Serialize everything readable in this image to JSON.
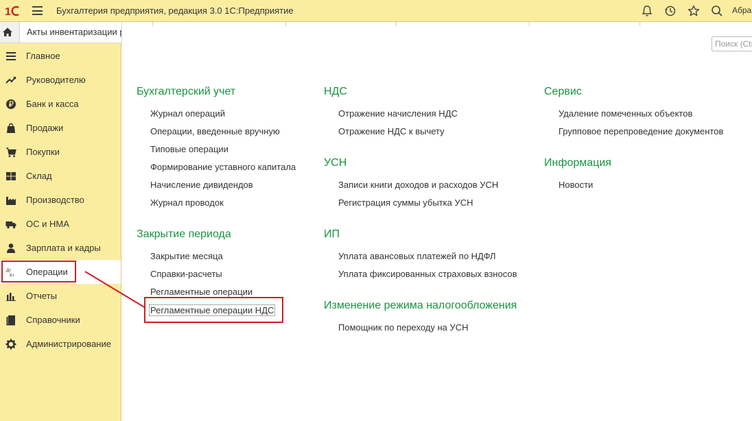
{
  "titlebar": {
    "logo": "1С",
    "app_title": "Бухгалтерия предприятия, редакция 3.0 1С:Предприятие",
    "user": "Абрам"
  },
  "tabs": {
    "open_tab": "Акты инвентаризации расчетов"
  },
  "sidebar": {
    "items": [
      {
        "label": "Главное",
        "icon": "menu-lines-icon"
      },
      {
        "label": "Руководителю",
        "icon": "trend-icon"
      },
      {
        "label": "Банк и касса",
        "icon": "ruble-icon"
      },
      {
        "label": "Продажи",
        "icon": "bag-icon"
      },
      {
        "label": "Покупки",
        "icon": "cart-icon"
      },
      {
        "label": "Склад",
        "icon": "warehouse-icon"
      },
      {
        "label": "Производство",
        "icon": "factory-icon"
      },
      {
        "label": "ОС и НМА",
        "icon": "truck-icon"
      },
      {
        "label": "Зарплата и кадры",
        "icon": "person-icon"
      },
      {
        "label": "Операции",
        "icon": "dt-kt-icon",
        "icon_text_top": "Дт",
        "icon_text_bottom": "Кт"
      },
      {
        "label": "Отчеты",
        "icon": "bar-chart-icon"
      },
      {
        "label": "Справочники",
        "icon": "books-icon"
      },
      {
        "label": "Администрирование",
        "icon": "gear-icon"
      }
    ],
    "active_index": 9
  },
  "search": {
    "placeholder": "Поиск (Ctrl+F)"
  },
  "sections": {
    "accounting": {
      "title": "Бухгалтерский учет",
      "links": [
        "Журнал операций",
        "Операции, введенные вручную",
        "Типовые операции",
        "Формирование уставного капитала",
        "Начисление дивидендов",
        "Журнал проводок"
      ]
    },
    "period_closing": {
      "title": "Закрытие периода",
      "links": [
        "Закрытие месяца",
        "Справки-расчеты",
        "Регламентные операции",
        "Регламентные операции НДС"
      ]
    },
    "vat": {
      "title": "НДС",
      "links": [
        "Отражение начисления НДС",
        "Отражение НДС к вычету"
      ]
    },
    "usn": {
      "title": "УСН",
      "links": [
        "Записи книги доходов и расходов УСН",
        "Регистрация суммы убытка УСН"
      ]
    },
    "ip": {
      "title": "ИП",
      "links": [
        "Уплата авансовых платежей по НДФЛ",
        "Уплата фиксированных страховых взносов"
      ]
    },
    "tax_change": {
      "title": "Изменение режима налогообложения",
      "links": [
        "Помощник по переходу на УСН"
      ]
    },
    "service": {
      "title": "Сервис",
      "links": [
        "Удаление помеченных объектов",
        "Групповое перепроведение документов"
      ]
    },
    "info": {
      "title": "Информация",
      "links": [
        "Новости"
      ]
    }
  },
  "colors": {
    "panel": "#fbeda0",
    "section_heading": "#1a9340",
    "highlight": "#d0201f"
  }
}
